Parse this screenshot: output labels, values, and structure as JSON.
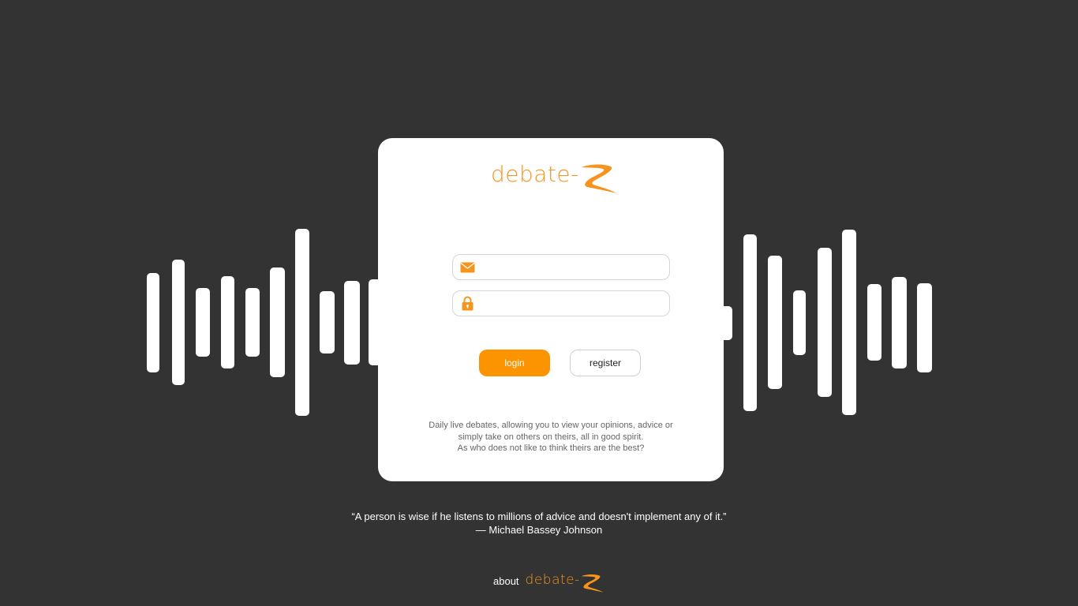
{
  "brand": {
    "name": "debate-",
    "color": "#f7941d",
    "mark_icon": "z-swoosh-icon"
  },
  "login_form": {
    "email_icon": "envelope-icon",
    "email_value": "",
    "password_icon": "lock-icon",
    "password_value": "",
    "login_label": "login",
    "register_label": "register"
  },
  "description": {
    "line1": "Daily live debates, allowing you to view your opinions, advice or",
    "line2": "simply take on others on theirs, all in good spirit.",
    "line3": "As who does not like to think theirs are the best?"
  },
  "quote": {
    "text": "“A person is wise if he listens to millions of advice and doesn't implement any of it.”",
    "author": "— Michael Bassey Johnson"
  },
  "footer": {
    "about_label": "about"
  },
  "colors": {
    "background": "#333333",
    "accent": "#fb9400",
    "card": "#ffffff"
  }
}
